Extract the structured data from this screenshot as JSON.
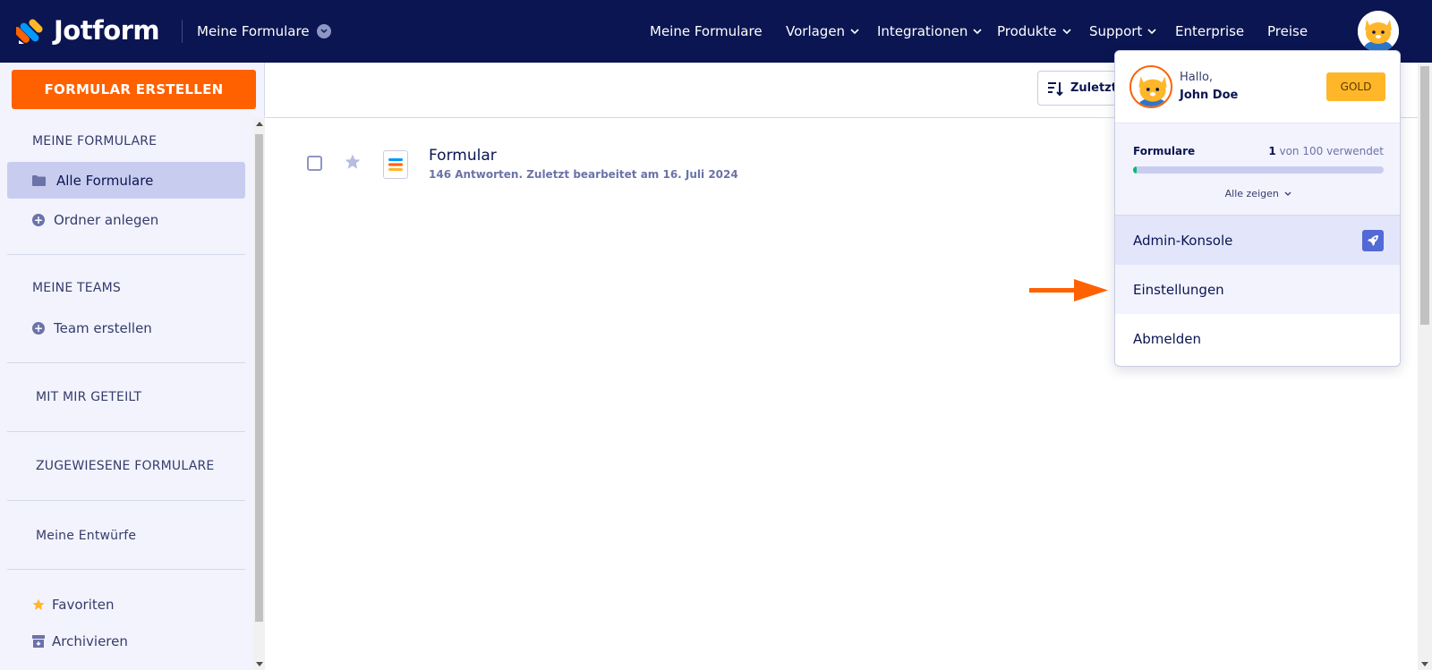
{
  "brand": {
    "name": "Jotform"
  },
  "topbar": {
    "my_forms_switch": "Meine Formulare",
    "nav": [
      {
        "label": "Meine Formulare",
        "has_chevron": false
      },
      {
        "label": "Vorlagen",
        "has_chevron": true
      },
      {
        "label": "Integrationen",
        "has_chevron": true
      },
      {
        "label": "Produkte",
        "has_chevron": true
      },
      {
        "label": "Support",
        "has_chevron": true
      },
      {
        "label": "Enterprise",
        "has_chevron": false
      },
      {
        "label": "Preise",
        "has_chevron": false
      }
    ]
  },
  "sidebar": {
    "create_button": "FORMULAR ERSTELLEN",
    "my_forms_heading": "MEINE FORMULARE",
    "all_forms": "Alle Formulare",
    "create_folder": "Ordner anlegen",
    "my_teams_heading": "MEINE TEAMS",
    "create_team": "Team erstellen",
    "shared_with_me": "MIT MIR GETEILT",
    "assigned_forms": "ZUGEWIESENE FORMULARE",
    "my_drafts": "Meine Entwürfe",
    "favorites": "Favoriten",
    "archive": "Archivieren"
  },
  "main": {
    "sort_label": "Zuletzt e",
    "forms": [
      {
        "title": "Formular",
        "meta": "146 Antworten. Zuletzt bearbeitet am 16. Juli 2024"
      }
    ]
  },
  "user_menu": {
    "greeting": "Hallo,",
    "name": "John Doe",
    "plan": "GOLD",
    "usage_label": "Formulare",
    "usage_used": "1",
    "usage_text": " von 100 verwendet",
    "usage_fraction": 0.01,
    "show_all": "Alle zeigen",
    "admin_console": "Admin-Konsole",
    "settings": "Einstellungen",
    "logout": "Abmelden"
  },
  "colors": {
    "navy": "#0a1551",
    "orange": "#ff6100",
    "gold": "#ffb629",
    "green": "#01bd6f",
    "sidebar_bg": "#f3f3fe"
  }
}
